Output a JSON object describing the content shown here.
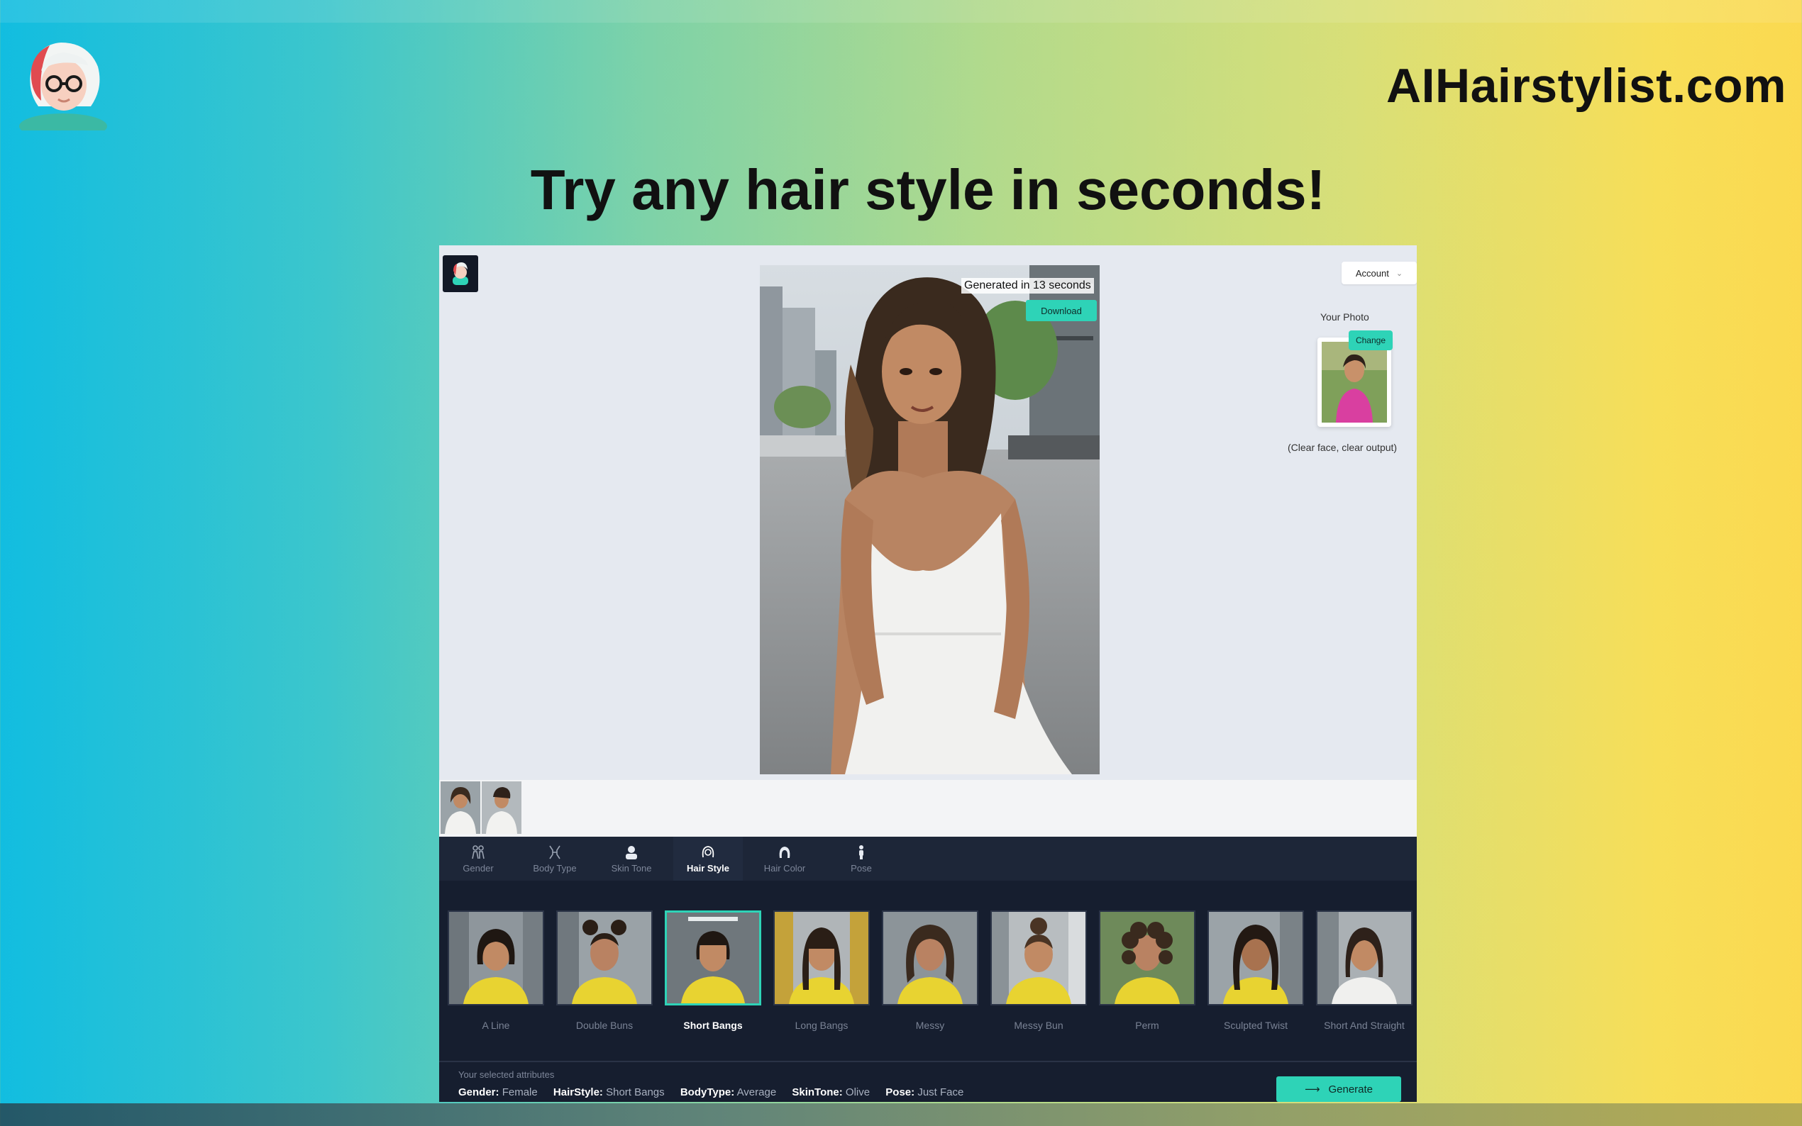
{
  "site": {
    "brand": "AIHairstylist.com",
    "headline": "Try any hair style in seconds!"
  },
  "app": {
    "account_label": "Account",
    "generated_label": "Generated in 13 seconds",
    "download_label": "Download",
    "your_photo_label": "Your Photo",
    "change_label": "Change",
    "clear_note": "(Clear face, clear output)"
  },
  "tabs": [
    {
      "label": "Gender",
      "icon": "gender-icon"
    },
    {
      "label": "Body Type",
      "icon": "body-type-icon"
    },
    {
      "label": "Skin Tone",
      "icon": "skin-tone-icon"
    },
    {
      "label": "Hair Style",
      "icon": "hair-style-icon",
      "active": true
    },
    {
      "label": "Hair Color",
      "icon": "hair-color-icon"
    },
    {
      "label": "Pose",
      "icon": "pose-icon"
    }
  ],
  "styles": [
    {
      "name": "A Line"
    },
    {
      "name": "Double Buns"
    },
    {
      "name": "Short Bangs",
      "selected": true
    },
    {
      "name": "Long Bangs"
    },
    {
      "name": "Messy"
    },
    {
      "name": "Messy Bun"
    },
    {
      "name": "Perm"
    },
    {
      "name": "Sculpted Twist"
    },
    {
      "name": "Short And Straight"
    }
  ],
  "attributes": {
    "title": "Your selected attributes",
    "gender_key": "Gender:",
    "gender_val": "Female",
    "hairstyle_key": "HairStyle:",
    "hairstyle_val": "Short Bangs",
    "bodytype_key": "BodyType:",
    "bodytype_val": "Average",
    "skintone_key": "SkinTone:",
    "skintone_val": "Olive",
    "pose_key": "Pose:",
    "pose_val": "Just Face"
  },
  "generate_label": "Generate",
  "colors": {
    "accent": "#2ed3b7",
    "panel": "#161e2f",
    "app_bg": "#e5e9f0"
  }
}
